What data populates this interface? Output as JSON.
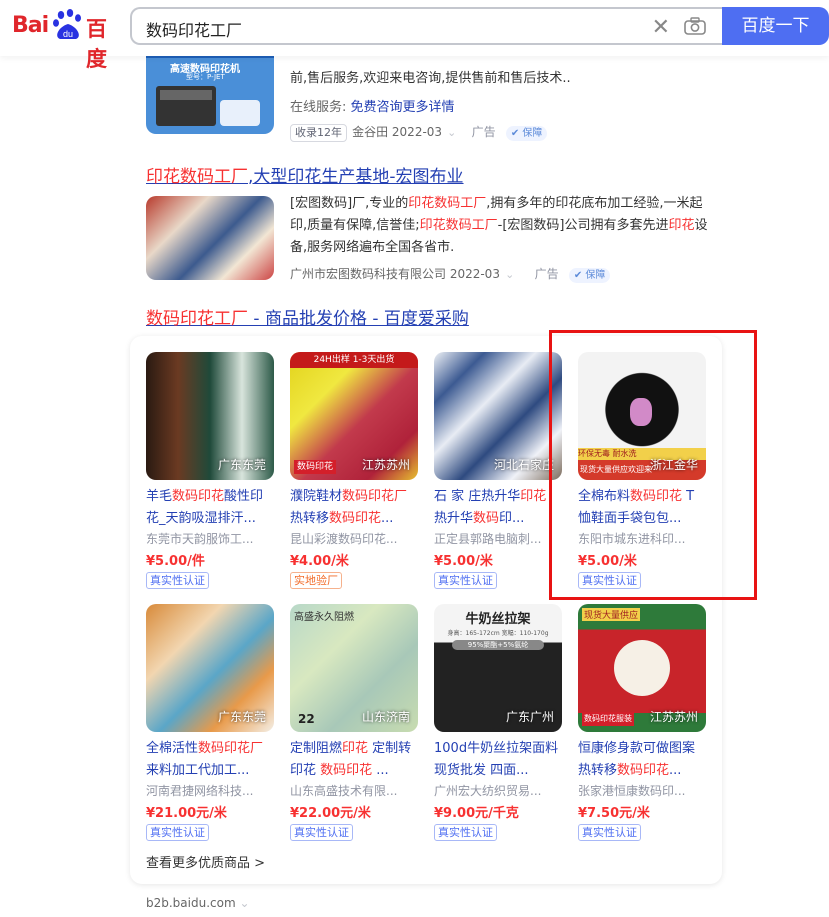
{
  "header": {
    "logo_bai": "Bai",
    "logo_du": "du",
    "logo_cn": "百度",
    "query": "数码印花工厂",
    "search_button": "百度一下"
  },
  "result1": {
    "thumb_caption": "高速数码印花机",
    "thumb_sub": "型号：P-JET",
    "desc_line2": "前,售后服务,欢迎来电咨询,提供售前和售后技术..",
    "online_label": "在线服务:",
    "online_link": "免费咨询更多详情",
    "tag": "收录12年",
    "company": "金谷田 2022-03",
    "ad": "广告",
    "bao": "保障"
  },
  "result2": {
    "title_hl": "印花数码工厂",
    "title_rest": ",大型印花生产基地-宏图布业",
    "desc": [
      {
        "t": "[宏图数码]厂,专业的",
        "h": false
      },
      {
        "t": "印花数码工厂",
        "h": true
      },
      {
        "t": ",拥有多年的印花底布加工经验,一米起印,质量有保障,信誉佳;",
        "h": false
      },
      {
        "t": "印花数码工厂",
        "h": true
      },
      {
        "t": "-[宏图数码]公司拥有多套先进",
        "h": false
      },
      {
        "t": "印花",
        "h": true
      },
      {
        "t": "设备,服务网络遍布全国各省市.",
        "h": false
      }
    ],
    "company": "广州市宏图数码科技有限公司 2022-03",
    "ad": "广告",
    "bao": "保障"
  },
  "result3": {
    "title_hl": "数码印花工厂",
    "title_rest": " - 商品批发价格 - 百度爱采购",
    "products": [
      {
        "name": [
          {
            "t": "羊毛",
            "h": false
          },
          {
            "t": "数码印花",
            "h": true
          },
          {
            "t": "酸性印花_天韵吸湿排汗...",
            "h": false
          }
        ],
        "location": "广东东莞",
        "company": "东莞市天韵服饰工...",
        "price": "¥5.00/件",
        "badge": "真实性认证",
        "badge_type": "b1"
      },
      {
        "name": [
          {
            "t": "濮院鞋材",
            "h": false
          },
          {
            "t": "数码印花厂",
            "h": true
          },
          {
            "t": "热转移",
            "h": false
          },
          {
            "t": "数码印花",
            "h": true
          },
          {
            "t": "...",
            "h": false
          }
        ],
        "location": "江苏苏州",
        "company": "昆山彩渡数码印花...",
        "price": "¥4.00/米",
        "badge": "实地验厂",
        "badge_type": "b2"
      },
      {
        "name": [
          {
            "t": "石 家 庄热升华",
            "h": false
          },
          {
            "t": "印花",
            "h": true
          },
          {
            "t": " 热升华",
            "h": false
          },
          {
            "t": "数码",
            "h": true
          },
          {
            "t": "印...",
            "h": false
          }
        ],
        "location": "河北石家庄",
        "company": "正定县郭路电脑刺...",
        "price": "¥5.00/米",
        "badge": "真实性认证",
        "badge_type": "b1"
      },
      {
        "name": [
          {
            "t": "全棉布料",
            "h": false
          },
          {
            "t": "数码印花",
            "h": true
          },
          {
            "t": " T恤鞋面手袋包包...",
            "h": false
          }
        ],
        "location": "浙江金华",
        "company": "东阳市城东进科印...",
        "price": "¥5.00/米",
        "badge": "真实性认证",
        "badge_type": "b1"
      },
      {
        "name": [
          {
            "t": "全棉活性",
            "h": false
          },
          {
            "t": "数码印花厂",
            "h": true
          },
          {
            "t": "来料加工代加工...",
            "h": false
          }
        ],
        "location": "广东东莞",
        "company": "河南君捷网络科技...",
        "price": "¥21.00元/米",
        "badge": "真实性认证",
        "badge_type": "b1"
      },
      {
        "name": [
          {
            "t": "定制阻燃",
            "h": false
          },
          {
            "t": "印花",
            "h": true
          },
          {
            "t": " 定制转印花 ",
            "h": false
          },
          {
            "t": "数码印花",
            "h": true
          },
          {
            "t": " ...",
            "h": false
          }
        ],
        "location": "山东济南",
        "company": "山东高盛技术有限...",
        "price": "¥22.00元/米",
        "badge": "真实性认证",
        "badge_type": "b1"
      },
      {
        "name": [
          {
            "t": "100d牛奶丝拉架面料现货批发 四面...",
            "h": false
          }
        ],
        "location": "广东广州",
        "company": "广州宏大纺织贸易...",
        "price": "¥9.00元/千克",
        "badge": "真实性认证",
        "badge_type": "b1"
      },
      {
        "name": [
          {
            "t": "恒康修身款可做图案热转移",
            "h": false
          },
          {
            "t": "数码印花",
            "h": true
          },
          {
            "t": "...",
            "h": false
          }
        ],
        "location": "江苏苏州",
        "company": "张家港恒康数码印...",
        "price": "¥7.50元/米",
        "badge": "真实性认证",
        "badge_type": "b1"
      }
    ],
    "overlay_texts": {
      "p2_banner": "24H出样 1-3天出货",
      "p2_label": "数码印花",
      "p4_banner1": "环保无毒 耐水洗",
      "p4_banner2": "现货大量供应欢迎来",
      "p6_banner": "高盛永久阻燃",
      "p6_num": "22",
      "p7_title": "牛奶丝拉架",
      "p7_sub": "身高：165-172cm 宽幅：110-170g",
      "p7_sub2": "95%聚酯+5%氨纶",
      "p8_banner": "现货大量供应",
      "p8_label": "数码印花服装"
    },
    "more": "查看更多优质商品 >"
  },
  "footer_url": "b2b.baidu.com",
  "colors": {
    "brand": "#4e6ef2",
    "highlight": "#f73131",
    "link": "#2440b3",
    "box": "#e81313"
  }
}
